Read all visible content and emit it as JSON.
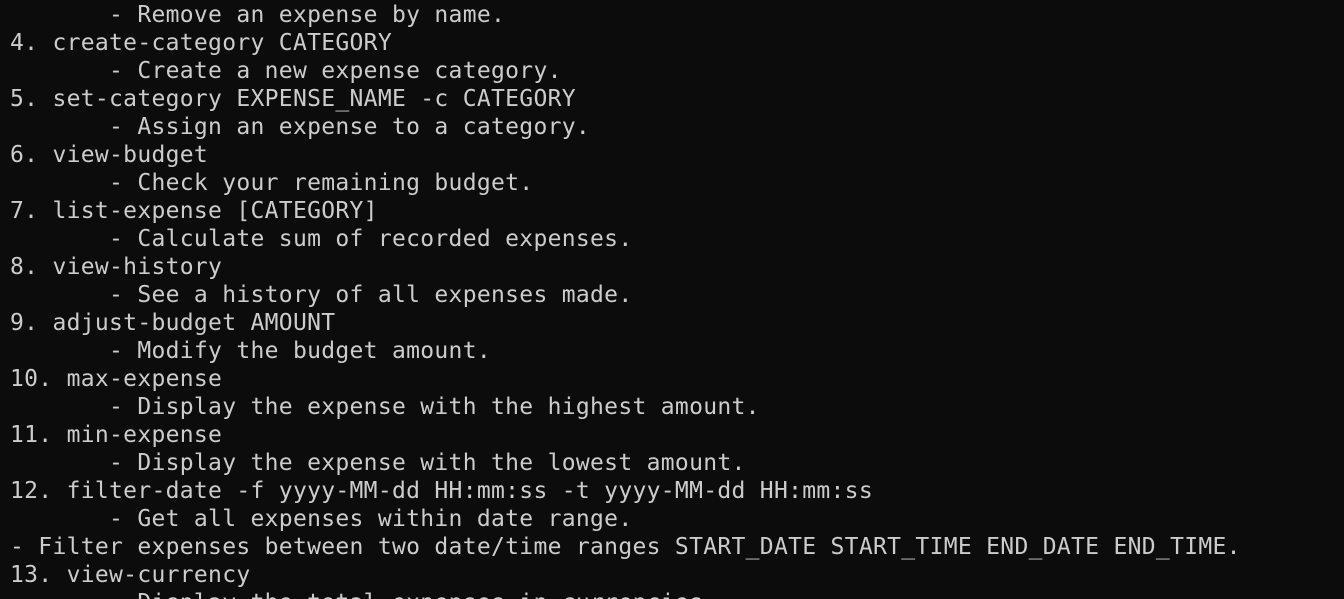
{
  "terminal": {
    "lines": [
      "       - Remove an expense by name.",
      "4. create-category CATEGORY",
      "       - Create a new expense category.",
      "5. set-category EXPENSE_NAME -c CATEGORY",
      "       - Assign an expense to a category.",
      "6. view-budget",
      "       - Check your remaining budget.",
      "7. list-expense [CATEGORY]",
      "       - Calculate sum of recorded expenses.",
      "8. view-history",
      "       - See a history of all expenses made.",
      "9. adjust-budget AMOUNT",
      "       - Modify the budget amount.",
      "10. max-expense",
      "       - Display the expense with the highest amount.",
      "11. min-expense",
      "       - Display the expense with the lowest amount.",
      "12. filter-date -f yyyy-MM-dd HH:mm:ss -t yyyy-MM-dd HH:mm:ss",
      "       - Get all expenses within date range.",
      "- Filter expenses between two date/time ranges START_DATE START_TIME END_DATE END_TIME.",
      "13. view-currency",
      "       - Display the total expenses in currencies."
    ]
  }
}
